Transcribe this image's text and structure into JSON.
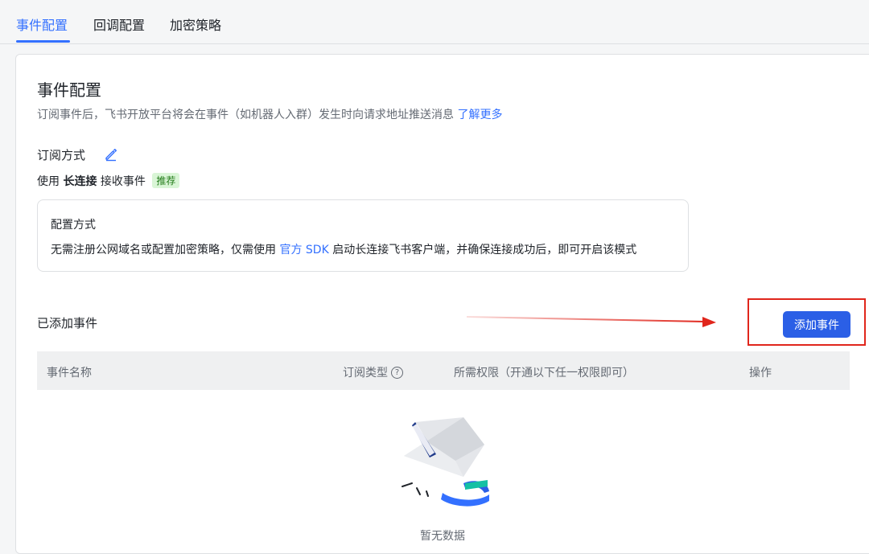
{
  "tabs": [
    {
      "label": "事件配置",
      "active": true
    },
    {
      "label": "回调配置",
      "active": false
    },
    {
      "label": "加密策略",
      "active": false
    }
  ],
  "page": {
    "title": "事件配置",
    "description": "订阅事件后，飞书开放平台将会在事件（如机器人入群）发生时向请求地址推送消息",
    "learn_more": "了解更多"
  },
  "subscription": {
    "title": "订阅方式",
    "mode_prefix": "使用",
    "mode_name": "长连接",
    "mode_suffix": "接收事件",
    "badge": "推荐"
  },
  "config": {
    "title": "配置方式",
    "text_before": "无需注册公网域名或配置加密策略，仅需使用",
    "sdk_link": "官方 SDK",
    "text_after": "启动长连接飞书客户端，并确保连接成功后，即可开启该模式"
  },
  "added_events": {
    "title": "已添加事件",
    "add_button": "添加事件"
  },
  "table": {
    "columns": {
      "name": "事件名称",
      "type": "订阅类型",
      "type_help": "?",
      "permissions": "所需权限（开通以下任一权限即可）",
      "action": "操作"
    },
    "rows": [],
    "empty_text": "暂无数据"
  },
  "colors": {
    "accent": "#3370ff",
    "button": "#2b5fe6",
    "badge_bg": "#d9f5d6",
    "annotation_red": "#e0261c"
  },
  "icons": [
    "edit-icon",
    "help-circle-icon",
    "empty-box-illustration"
  ]
}
